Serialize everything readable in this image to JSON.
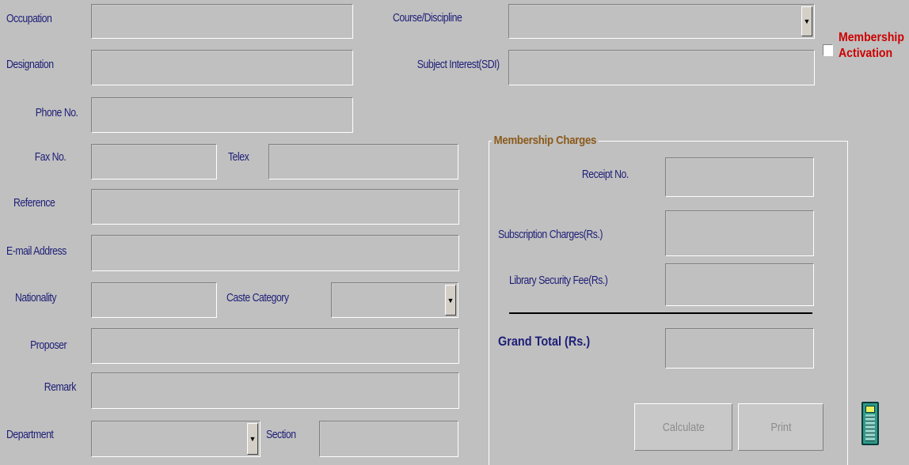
{
  "left_form": {
    "occupation_label": "Occupation",
    "designation_label": "Designation",
    "phone_label": "Phone No.",
    "fax_label": "Fax No.",
    "telex_label": "Telex",
    "reference_label": "Reference",
    "email_label": "E-mail Address",
    "nationality_label": "Nationality",
    "caste_label": "Caste Category",
    "proposer_label": "Proposer",
    "remark_label": "Remark",
    "department_label": "Department",
    "section_label": "Section",
    "occupation_value": "",
    "designation_value": "",
    "phone_value": "",
    "fax_value": "",
    "telex_value": "",
    "reference_value": "",
    "email_value": "",
    "nationality_value": "",
    "caste_value": "",
    "proposer_value": "",
    "remark_value": "",
    "department_value": "",
    "section_value": ""
  },
  "right_form": {
    "course_label": "Course/Discipline",
    "subject_label": "Subject Interest(SDI)",
    "course_value": "",
    "subject_value": ""
  },
  "membership_activation": {
    "label_line1": "Membership",
    "label_line2": "Activation",
    "checked": false
  },
  "charges": {
    "title": "Membership Charges",
    "receipt_label": "Receipt No.",
    "subscription_label": "Subscription Charges(Rs.)",
    "security_label": "Library Security Fee(Rs.)",
    "grand_total_label": "Grand Total (Rs.)",
    "receipt_value": "",
    "subscription_value": "",
    "security_value": "",
    "grand_total_value": ""
  },
  "buttons": {
    "calculate": "Calculate",
    "print": "Print"
  },
  "icons": {
    "dropdown": "▼",
    "calculator": "calculator-icon"
  }
}
